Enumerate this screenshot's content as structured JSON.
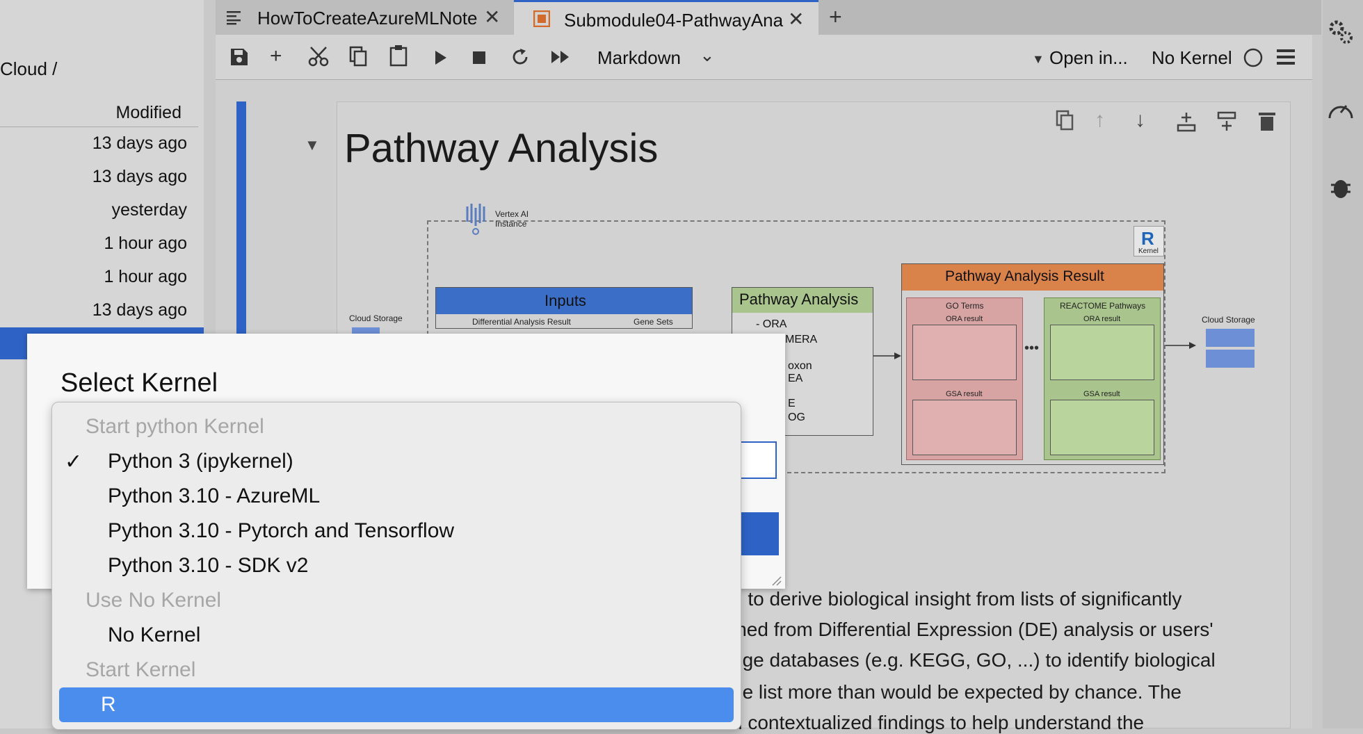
{
  "file_panel": {
    "breadcrumb": "Cloud /",
    "column_modified": "Modified",
    "rows": [
      "13 days ago",
      "13 days ago",
      "yesterday",
      "1 hour ago",
      "1 hour ago",
      "13 days ago"
    ]
  },
  "tabs": [
    {
      "title": "HowToCreateAzureMLNote",
      "icon": "document-icon"
    },
    {
      "title": "Submodule04-PathwayAna",
      "icon": "notebook-icon"
    }
  ],
  "toolbar": {
    "cell_type": "Markdown",
    "open_in": "Open in...",
    "kernel": "No Kernel"
  },
  "cell": {
    "heading": "Pathway Analysis"
  },
  "diagram": {
    "vertex_label_1": "Vertex AI",
    "vertex_label_2": "Instance",
    "cloud_storage_left": "Cloud Storage",
    "cloud_storage_right": "Cloud Storage",
    "inputs_title": "Inputs",
    "inputs_sub1": "Differential Analysis Result",
    "inputs_sub2": "Gene Sets",
    "pathway_title": "Pathway Analysis",
    "pathway_items": [
      "- ORA",
      "MERA",
      "oxon",
      "EA",
      "E",
      "OG"
    ],
    "result_title": "Pathway Analysis Result",
    "go_terms": "GO Terms",
    "reactome": "REACTOME Pathways",
    "ora_result": "ORA result",
    "gsa_result": "GSA result",
    "kernel_label": "Kernel"
  },
  "markdown_lines": [
    "d to derive biological insight from lists of significantly",
    "ined from Differential Expression (DE) analysis or users'",
    "dge databases (e.g. KEGG, GO, ...) to identify biological",
    "ne list more than would be expected by chance. The",
    "d contextualized findings to help understand the"
  ],
  "dialog": {
    "title": "Select Kernel"
  },
  "kernel_menu": {
    "group_python": "Start python Kernel",
    "items_python": [
      "Python 3 (ipykernel)",
      "Python 3.10 - AzureML",
      "Python 3.10 - Pytorch and Tensorflow",
      "Python 3.10 - SDK v2"
    ],
    "selected": "Python 3 (ipykernel)",
    "check": "✓",
    "group_none": "Use No Kernel",
    "item_none": "No Kernel",
    "group_start": "Start Kernel",
    "item_r": "R"
  },
  "colors": {
    "accent": "#2e63c5",
    "highlight": "#4b8ded",
    "inputs_header": "#3b6ec6",
    "pathway_header": "#a9c48c",
    "result_header": "#d9834a"
  }
}
